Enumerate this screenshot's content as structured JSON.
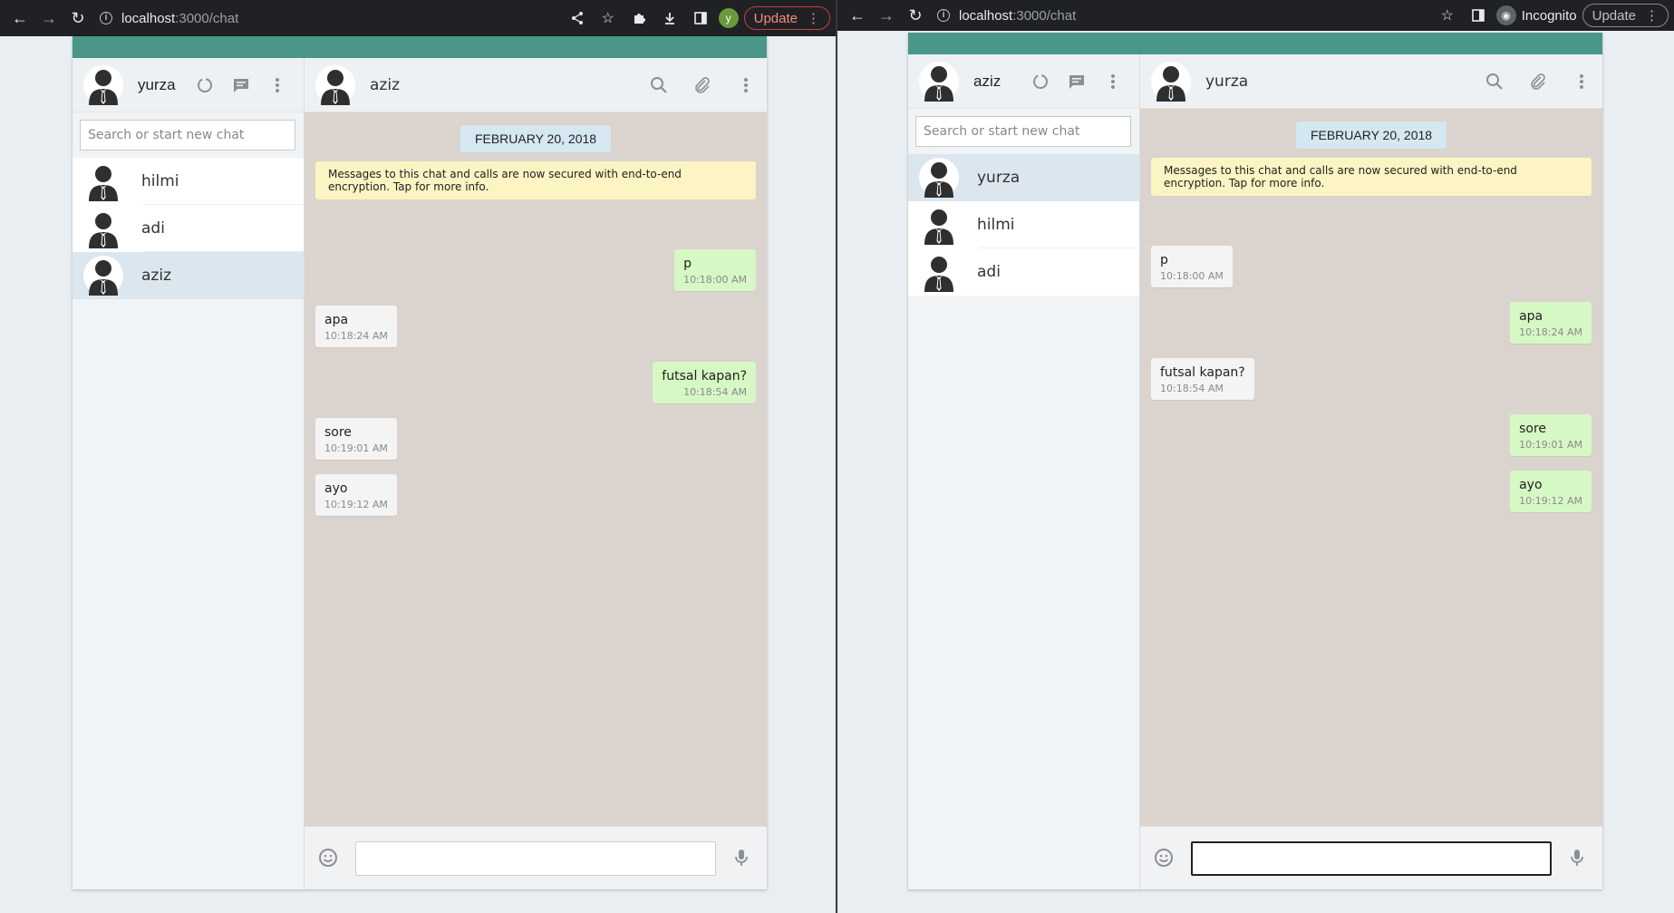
{
  "browser_left": {
    "url_host": "localhost",
    "url_path": ":3000/chat",
    "profile_initial": "y",
    "update_label": "Update"
  },
  "browser_right": {
    "url_host": "localhost",
    "url_path": ":3000/chat",
    "incognito_label": "Incognito",
    "update_label": "Update"
  },
  "left_app": {
    "user_name": "yurza",
    "search_placeholder": "Search or start new chat",
    "contacts": [
      {
        "name": "hilmi",
        "active": false
      },
      {
        "name": "adi",
        "active": false
      },
      {
        "name": "aziz",
        "active": true
      }
    ],
    "chat_with": "aziz",
    "date_label": "FEBRUARY 20, 2018",
    "encryption_note": "Messages to this chat and calls are now secured with end-to-end encryption. Tap for more info.",
    "messages": [
      {
        "text": "p",
        "time": "10:18:00 AM",
        "dir": "out"
      },
      {
        "text": "apa",
        "time": "10:18:24 AM",
        "dir": "in"
      },
      {
        "text": "futsal kapan?",
        "time": "10:18:54 AM",
        "dir": "out"
      },
      {
        "text": "sore",
        "time": "10:19:01 AM",
        "dir": "in"
      },
      {
        "text": "ayo",
        "time": "10:19:12 AM",
        "dir": "in"
      }
    ]
  },
  "right_app": {
    "user_name": "aziz",
    "search_placeholder": "Search or start new chat",
    "contacts": [
      {
        "name": "yurza",
        "active": true
      },
      {
        "name": "hilmi",
        "active": false
      },
      {
        "name": "adi",
        "active": false
      }
    ],
    "chat_with": "yurza",
    "date_label": "FEBRUARY 20, 2018",
    "encryption_note": "Messages to this chat and calls are now secured with end-to-end encryption. Tap for more info.",
    "messages": [
      {
        "text": "p",
        "time": "10:18:00 AM",
        "dir": "in"
      },
      {
        "text": "apa",
        "time": "10:18:24 AM",
        "dir": "out"
      },
      {
        "text": "futsal kapan?",
        "time": "10:18:54 AM",
        "dir": "in"
      },
      {
        "text": "sore",
        "time": "10:19:01 AM",
        "dir": "out"
      },
      {
        "text": "ayo",
        "time": "10:19:12 AM",
        "dir": "out"
      }
    ]
  },
  "colors": {
    "accent_teal": "#4a9688",
    "outgoing_bubble": "#d6f8c4",
    "incoming_bubble": "#f4f4f4",
    "chat_background": "#dbd3cd",
    "date_badge": "#d5e7f1",
    "encryption_note": "#fcf4c3"
  }
}
